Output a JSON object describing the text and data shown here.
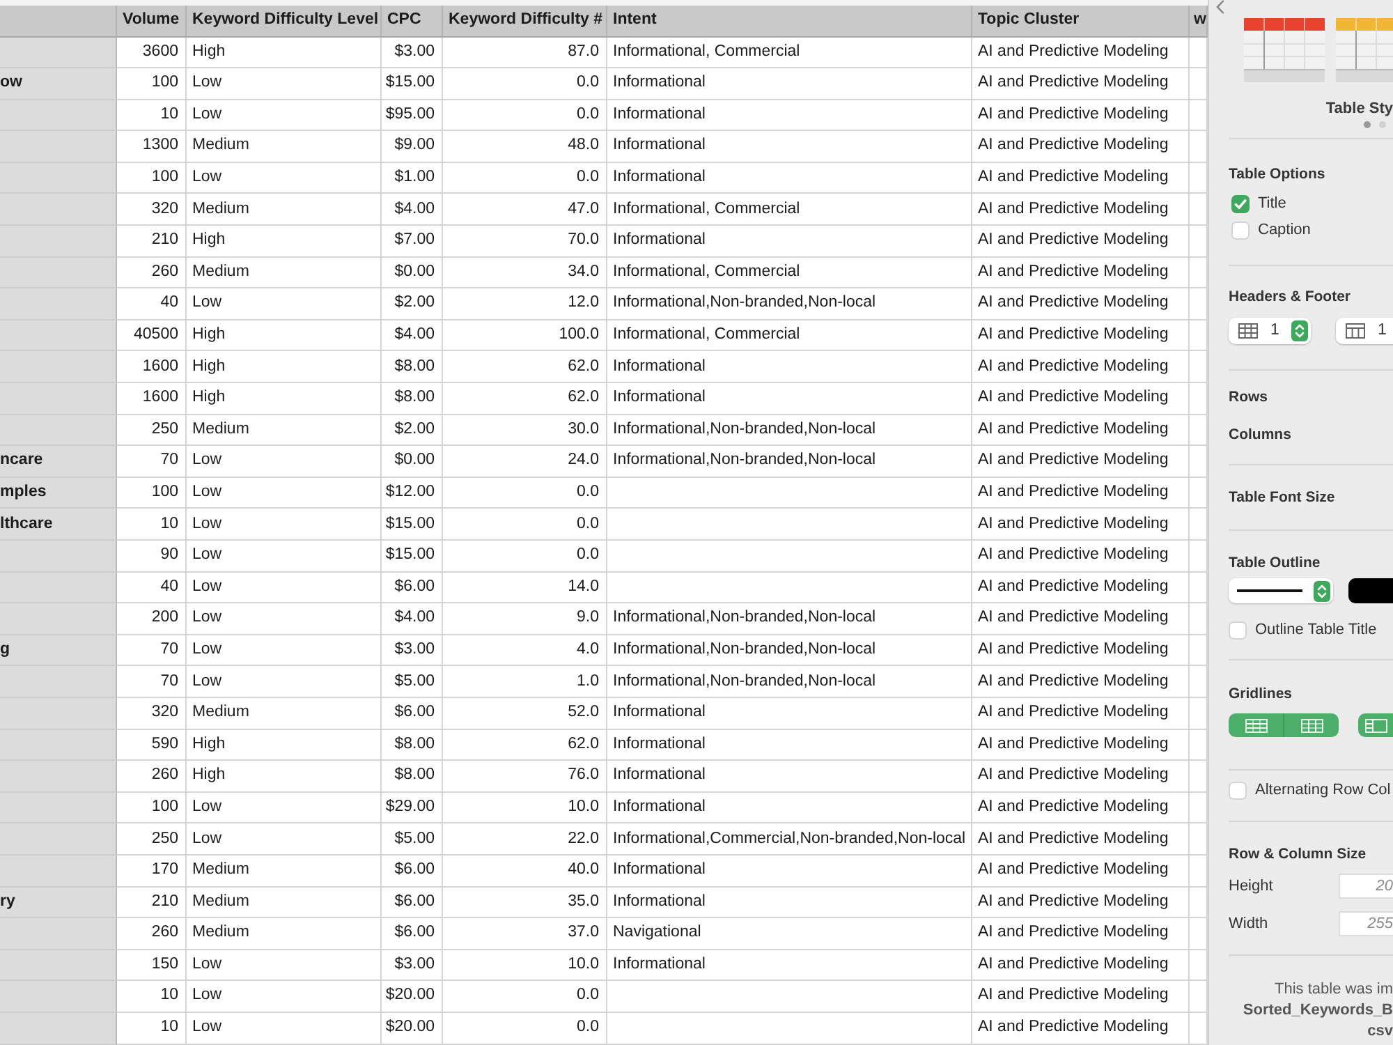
{
  "table": {
    "columns": [
      {
        "label": "Volume",
        "kind": "number"
      },
      {
        "label": "Keyword Difficulty Level",
        "kind": "text"
      },
      {
        "label": "CPC",
        "kind": "number"
      },
      {
        "label": "Keyword Difficulty #",
        "kind": "number"
      },
      {
        "label": "Intent",
        "kind": "text"
      },
      {
        "label": "Topic Cluster",
        "kind": "text"
      },
      {
        "label": "w",
        "kind": "text"
      }
    ],
    "rows": [
      {
        "volume": "3600",
        "difficulty_level": "High",
        "cpc": "$3.00",
        "difficulty_number": "87.0",
        "intent": "Informational, Commercial",
        "topic_cluster": "AI and Predictive Modeling"
      },
      {
        "row_header": "ow",
        "volume": "100",
        "difficulty_level": "Low",
        "cpc": "$15.00",
        "difficulty_number": "0.0",
        "intent": "Informational",
        "topic_cluster": "AI and Predictive Modeling"
      },
      {
        "volume": "10",
        "difficulty_level": "Low",
        "cpc": "$95.00",
        "difficulty_number": "0.0",
        "intent": "Informational",
        "topic_cluster": "AI and Predictive Modeling"
      },
      {
        "volume": "1300",
        "difficulty_level": "Medium",
        "cpc": "$9.00",
        "difficulty_number": "48.0",
        "intent": "Informational",
        "topic_cluster": "AI and Predictive Modeling"
      },
      {
        "volume": "100",
        "difficulty_level": "Low",
        "cpc": "$1.00",
        "difficulty_number": "0.0",
        "intent": "Informational",
        "topic_cluster": "AI and Predictive Modeling"
      },
      {
        "volume": "320",
        "difficulty_level": "Medium",
        "cpc": "$4.00",
        "difficulty_number": "47.0",
        "intent": "Informational, Commercial",
        "topic_cluster": "AI and Predictive Modeling"
      },
      {
        "volume": "210",
        "difficulty_level": "High",
        "cpc": "$7.00",
        "difficulty_number": "70.0",
        "intent": "Informational",
        "topic_cluster": "AI and Predictive Modeling"
      },
      {
        "volume": "260",
        "difficulty_level": "Medium",
        "cpc": "$0.00",
        "difficulty_number": "34.0",
        "intent": "Informational, Commercial",
        "topic_cluster": "AI and Predictive Modeling"
      },
      {
        "volume": "40",
        "difficulty_level": "Low",
        "cpc": "$2.00",
        "difficulty_number": "12.0",
        "intent": "Informational,Non-branded,Non-local",
        "topic_cluster": "AI and Predictive Modeling"
      },
      {
        "volume": "40500",
        "difficulty_level": "High",
        "cpc": "$4.00",
        "difficulty_number": "100.0",
        "intent": "Informational, Commercial",
        "topic_cluster": "AI and Predictive Modeling"
      },
      {
        "volume": "1600",
        "difficulty_level": "High",
        "cpc": "$8.00",
        "difficulty_number": "62.0",
        "intent": "Informational",
        "topic_cluster": "AI and Predictive Modeling"
      },
      {
        "volume": "1600",
        "difficulty_level": "High",
        "cpc": "$8.00",
        "difficulty_number": "62.0",
        "intent": "Informational",
        "topic_cluster": "AI and Predictive Modeling"
      },
      {
        "volume": "250",
        "difficulty_level": "Medium",
        "cpc": "$2.00",
        "difficulty_number": "30.0",
        "intent": "Informational,Non-branded,Non-local",
        "topic_cluster": "AI and Predictive Modeling"
      },
      {
        "row_header": "ncare",
        "volume": "70",
        "difficulty_level": "Low",
        "cpc": "$0.00",
        "difficulty_number": "24.0",
        "intent": "Informational,Non-branded,Non-local",
        "topic_cluster": "AI and Predictive Modeling"
      },
      {
        "row_header": "mples",
        "volume": "100",
        "difficulty_level": "Low",
        "cpc": "$12.00",
        "difficulty_number": "0.0",
        "topic_cluster": "AI and Predictive Modeling"
      },
      {
        "row_header": "lthcare",
        "volume": "10",
        "difficulty_level": "Low",
        "cpc": "$15.00",
        "difficulty_number": "0.0",
        "topic_cluster": "AI and Predictive Modeling"
      },
      {
        "volume": "90",
        "difficulty_level": "Low",
        "cpc": "$15.00",
        "difficulty_number": "0.0",
        "topic_cluster": "AI and Predictive Modeling"
      },
      {
        "volume": "40",
        "difficulty_level": "Low",
        "cpc": "$6.00",
        "difficulty_number": "14.0",
        "topic_cluster": "AI and Predictive Modeling"
      },
      {
        "volume": "200",
        "difficulty_level": "Low",
        "cpc": "$4.00",
        "difficulty_number": "9.0",
        "intent": "Informational,Non-branded,Non-local",
        "topic_cluster": "AI and Predictive Modeling"
      },
      {
        "row_header": "g",
        "volume": "70",
        "difficulty_level": "Low",
        "cpc": "$3.00",
        "difficulty_number": "4.0",
        "intent": "Informational,Non-branded,Non-local",
        "topic_cluster": "AI and Predictive Modeling"
      },
      {
        "volume": "70",
        "difficulty_level": "Low",
        "cpc": "$5.00",
        "difficulty_number": "1.0",
        "intent": "Informational,Non-branded,Non-local",
        "topic_cluster": "AI and Predictive Modeling"
      },
      {
        "volume": "320",
        "difficulty_level": "Medium",
        "cpc": "$6.00",
        "difficulty_number": "52.0",
        "intent": "Informational",
        "topic_cluster": "AI and Predictive Modeling"
      },
      {
        "volume": "590",
        "difficulty_level": "High",
        "cpc": "$8.00",
        "difficulty_number": "62.0",
        "intent": "Informational",
        "topic_cluster": "AI and Predictive Modeling"
      },
      {
        "volume": "260",
        "difficulty_level": "High",
        "cpc": "$8.00",
        "difficulty_number": "76.0",
        "intent": "Informational",
        "topic_cluster": "AI and Predictive Modeling"
      },
      {
        "volume": "100",
        "difficulty_level": "Low",
        "cpc": "$29.00",
        "difficulty_number": "10.0",
        "intent": "Informational",
        "topic_cluster": "AI and Predictive Modeling"
      },
      {
        "volume": "250",
        "difficulty_level": "Low",
        "cpc": "$5.00",
        "difficulty_number": "22.0",
        "intent": "Informational,Commercial,Non-branded,Non-local",
        "topic_cluster": "AI and Predictive Modeling"
      },
      {
        "volume": "170",
        "difficulty_level": "Medium",
        "cpc": "$6.00",
        "difficulty_number": "40.0",
        "intent": "Informational",
        "topic_cluster": "AI and Predictive Modeling"
      },
      {
        "row_header": "ry",
        "volume": "210",
        "difficulty_level": "Medium",
        "cpc": "$6.00",
        "difficulty_number": "35.0",
        "intent": "Informational",
        "topic_cluster": "AI and Predictive Modeling"
      },
      {
        "volume": "260",
        "difficulty_level": "Medium",
        "cpc": "$6.00",
        "difficulty_number": "37.0",
        "intent": "Navigational",
        "topic_cluster": "AI and Predictive Modeling"
      },
      {
        "volume": "150",
        "difficulty_level": "Low",
        "cpc": "$3.00",
        "difficulty_number": "10.0",
        "intent": "Informational",
        "topic_cluster": "AI and Predictive Modeling"
      },
      {
        "volume": "10",
        "difficulty_level": "Low",
        "cpc": "$20.00",
        "difficulty_number": "0.0",
        "topic_cluster": "AI and Predictive Modeling"
      },
      {
        "volume": "10",
        "difficulty_level": "Low",
        "cpc": "$20.00",
        "difficulty_number": "0.0",
        "topic_cluster": "AI and Predictive Modeling"
      }
    ]
  },
  "inspector": {
    "table_styles": {
      "label": "Table Sty",
      "swatches": [
        {
          "color": "#e8432f"
        },
        {
          "color": "#f2b535"
        }
      ],
      "pages": [
        {
          "selected": true
        },
        {
          "selected": false
        }
      ]
    },
    "table_options": {
      "title": "Table Options",
      "checkboxes": [
        {
          "label": "Title",
          "checked": true
        },
        {
          "label": "Caption",
          "checked": false
        }
      ]
    },
    "headers_footer": {
      "title": "Headers & Footer",
      "steppers": [
        {
          "value": "1"
        },
        {
          "value": "1"
        }
      ]
    },
    "rows_label": "Rows",
    "columns_label": "Columns",
    "font_size": {
      "title": "Table Font Size"
    },
    "table_outline": {
      "title": "Table Outline",
      "checkbox": {
        "label": "Outline Table Title",
        "checked": false
      }
    },
    "gridlines": {
      "title": "Gridlines",
      "buttons": [
        {
          "on": true
        },
        {
          "on": true
        },
        {
          "on": true
        }
      ]
    },
    "alternating_rows": {
      "label": "Alternating Row Col",
      "checked": false
    },
    "row_column_size": {
      "title": "Row & Column Size",
      "fields": [
        {
          "label": "Height",
          "placeholder": "20"
        },
        {
          "label": "Width",
          "placeholder": "255"
        }
      ]
    },
    "note": "This table was im\n**Sorted_Keywords_B**\n**csv**"
  }
}
